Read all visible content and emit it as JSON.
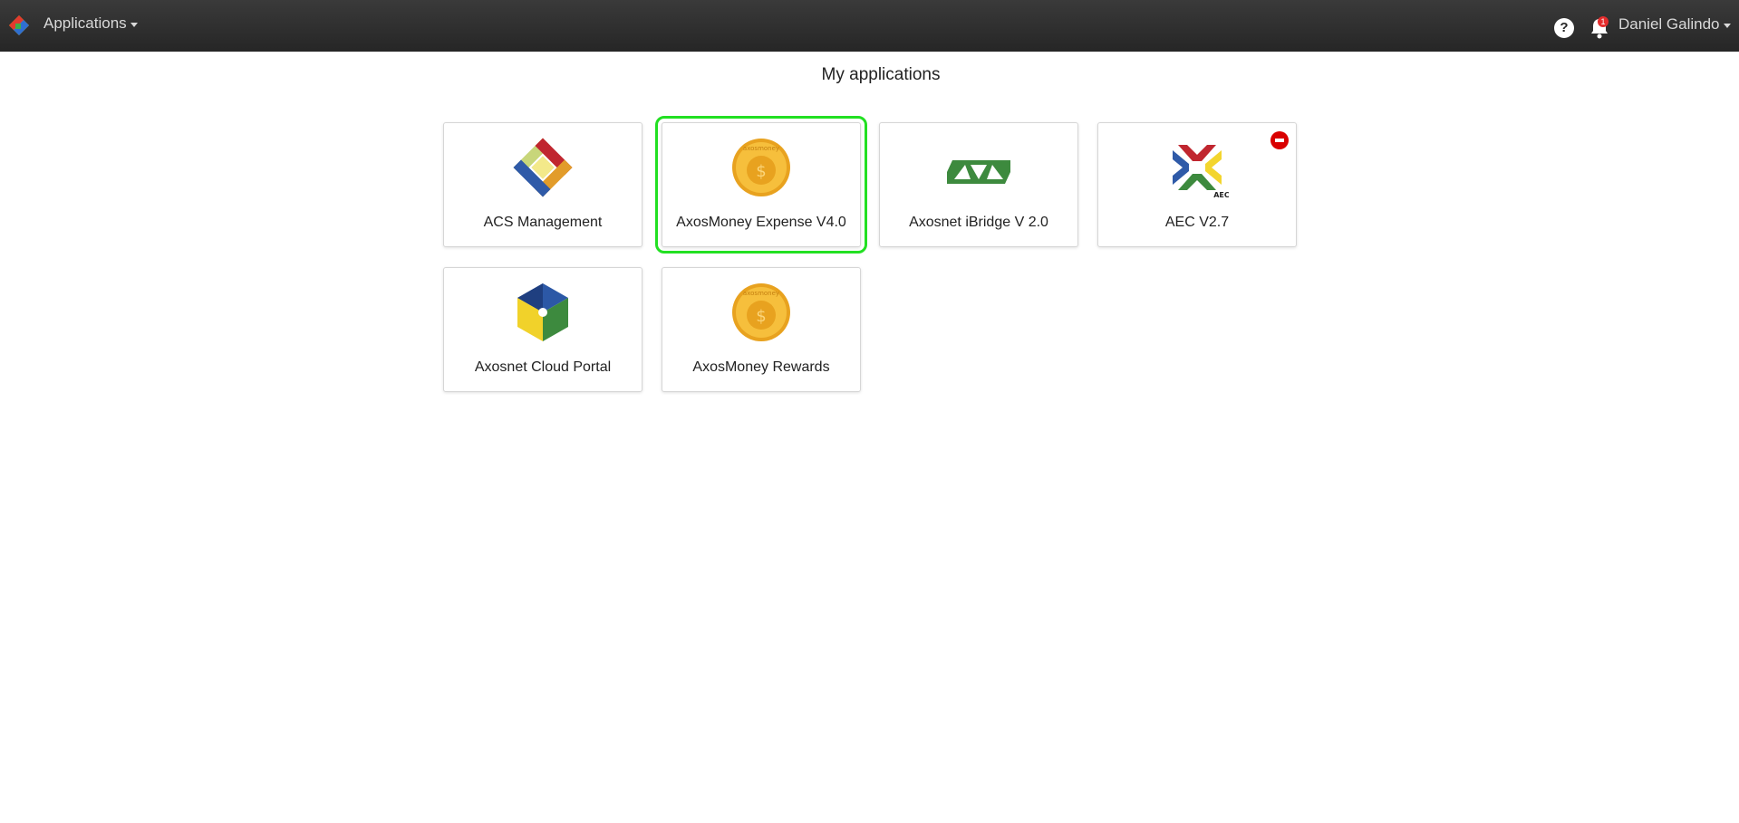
{
  "navbar": {
    "apps_label": "Applications",
    "user_name": "Daniel Galindo",
    "help_label": "?",
    "notification_count": "1"
  },
  "page": {
    "title": "My applications"
  },
  "apps": [
    {
      "label": "ACS Management",
      "icon": "acs-diamond-icon"
    },
    {
      "label": "AxosMoney Expense V4.0",
      "icon": "axosmoney-coin-icon",
      "selected": true
    },
    {
      "label": "Axosnet iBridge V 2.0",
      "icon": "ibridge-triangles-icon"
    },
    {
      "label": "AEC V2.7",
      "icon": "aec-cross-icon",
      "badge": "remove"
    },
    {
      "label": "Axosnet Cloud Portal",
      "icon": "cloud-portal-cube-icon"
    },
    {
      "label": "AxosMoney Rewards",
      "icon": "axosmoney-coin-icon"
    }
  ],
  "icon_text": {
    "coin_mark": "axosmoney",
    "aec_mark": "AEC"
  },
  "colors": {
    "navbar": "#2b2b2b",
    "selection_outline": "#22e022",
    "remove_badge": "#d90000",
    "notification_badge": "#e52d2d"
  }
}
